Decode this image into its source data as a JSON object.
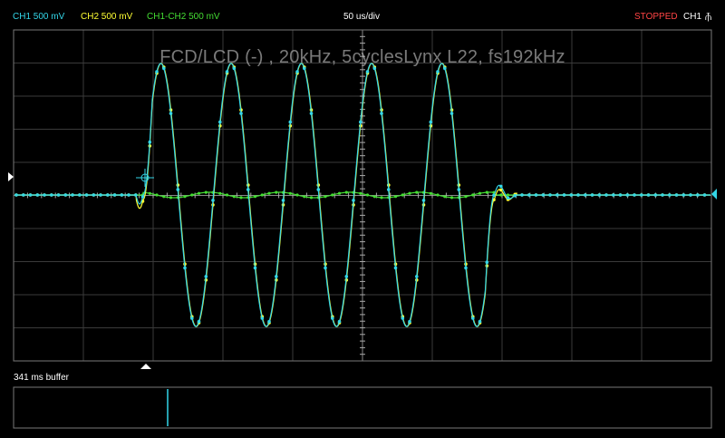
{
  "header": {
    "ch1": "CH1 500 mV",
    "ch2": "CH2 500 mV",
    "math": "CH1-CH2 500 mV",
    "timebase": "50 us/div",
    "status": "STOPPED",
    "trigger_channel": "CH1",
    "trigger_edge_icon": "rising-edge-icon",
    "trigger_edge_glyph": "⫚"
  },
  "colors": {
    "ch1": "#33d6e8",
    "ch2": "#ffff33",
    "math": "#44dd33",
    "status": "#ff4444",
    "grid": "#3a3a3a",
    "frame": "#777777"
  },
  "plot": {
    "title": "FCD/LCD  (-) , 20kHz, 5cyclesLynx L22, fs192kHz"
  },
  "buffer": {
    "label": "341 ms buffer"
  }
}
